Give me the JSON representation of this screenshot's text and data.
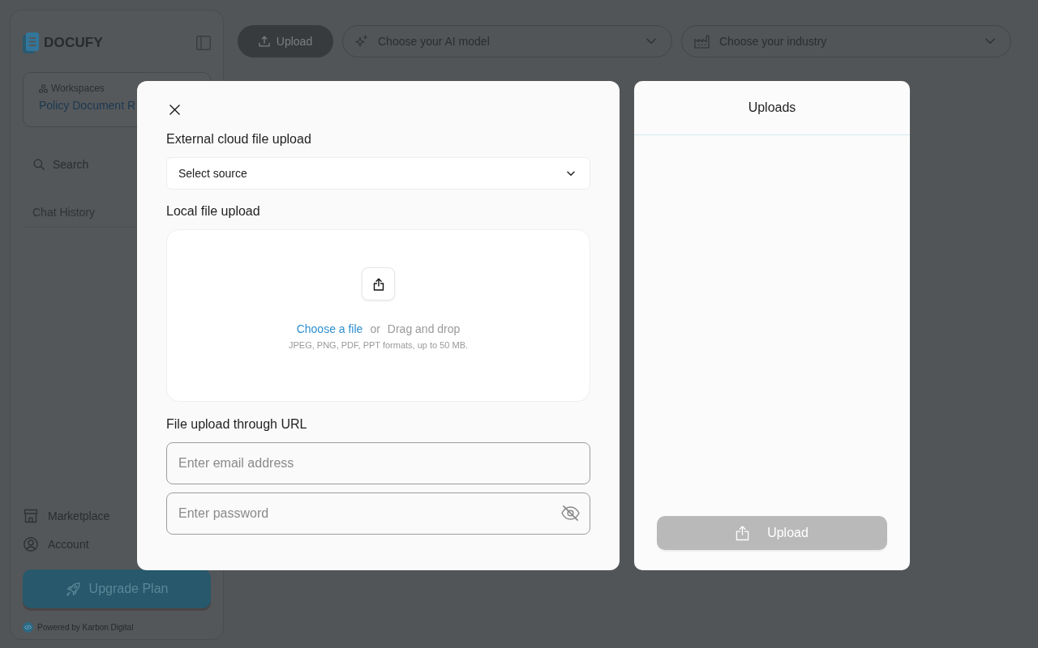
{
  "sidebar": {
    "logo": "DOCUFY",
    "workspace": {
      "label": "Workspaces",
      "name": "Policy Document R"
    },
    "search": {
      "label": "Search"
    },
    "history_title": "Chat History",
    "nav_items": [
      {
        "label": "Marketplace"
      },
      {
        "label": "Account"
      }
    ],
    "upgrade_button": "Upgrade Plan",
    "footer": "Powered by Karbon Digital"
  },
  "toolbar": {
    "upload_button": "Upload",
    "model_select": {
      "placeholder": "Choose your AI model"
    },
    "industry_select": {
      "placeholder": "Choose your industry"
    }
  },
  "upload_dialog": {
    "cloud": {
      "title": "External cloud file upload",
      "source_select": {
        "label": "Select source"
      }
    },
    "local": {
      "title": "Local file upload",
      "choose_link": "Choose a file",
      "separator": "or",
      "drag_text": "Drag and drop",
      "hint": "JPEG, PNG, PDF, PPT formats, up to 50 MB."
    },
    "url": {
      "title": "File upload through URL",
      "email": {
        "placeholder": "Enter email address"
      },
      "password": {
        "placeholder": "Enter password",
        "visible": false
      }
    }
  },
  "uploads_panel": {
    "title": "Uploads",
    "upload_button": {
      "label": "Upload",
      "disabled": true
    }
  }
}
